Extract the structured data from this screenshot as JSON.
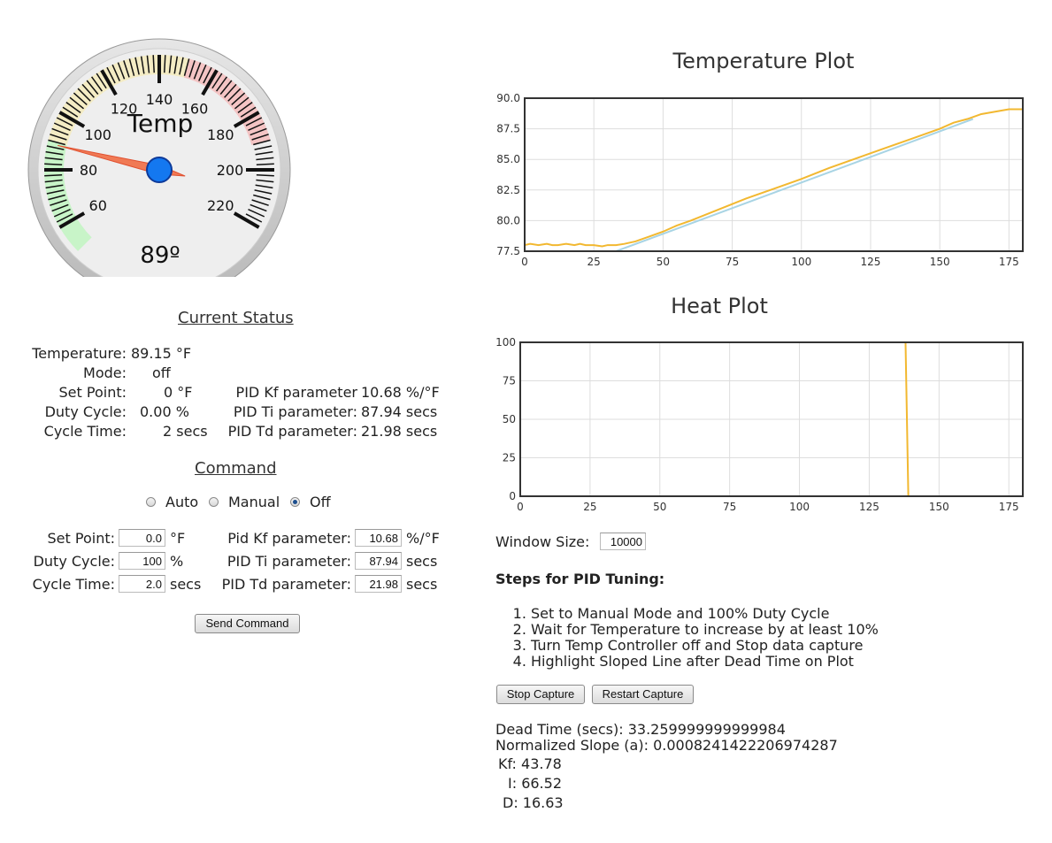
{
  "gauge": {
    "title": "Temp",
    "value_display": "89º",
    "value": 89,
    "min": 50,
    "max": 230,
    "major_ticks": [
      "60",
      "80",
      "100",
      "120",
      "140",
      "160",
      "180",
      "200",
      "220"
    ],
    "bands": [
      {
        "from": 50,
        "to": 90,
        "color": "#c8f4c8"
      },
      {
        "from": 90,
        "to": 150,
        "color": "#f4ecc4"
      },
      {
        "from": 150,
        "to": 190,
        "color": "#f4c4c4"
      }
    ]
  },
  "status": {
    "heading": "Current Status",
    "rows": [
      {
        "label": "Temperature:",
        "value": "89.15 °F"
      },
      {
        "label": "Mode:",
        "value": "off"
      },
      {
        "label": "Set Point:",
        "value": "0 °F"
      },
      {
        "label": "Duty Cycle:",
        "value": "0.00 %"
      },
      {
        "label": "Cycle Time:",
        "value": "2 secs"
      }
    ],
    "pid": [
      {
        "label": "PID Kf parameter",
        "value": "10.68 %/°F"
      },
      {
        "label": "PID Ti parameter:",
        "value": "87.94 secs"
      },
      {
        "label": "PID Td parameter:",
        "value": "21.98 secs"
      }
    ]
  },
  "command": {
    "heading": "Command",
    "modes": [
      {
        "label": "Auto",
        "selected": false
      },
      {
        "label": "Manual",
        "selected": false
      },
      {
        "label": "Off",
        "selected": true
      }
    ],
    "fields": [
      {
        "label": "Set Point:",
        "value": "0.0",
        "unit": "°F"
      },
      {
        "label": "Duty Cycle:",
        "value": "100",
        "unit": "%"
      },
      {
        "label": "Cycle Time:",
        "value": "2.0",
        "unit": "secs"
      }
    ],
    "pid_fields": [
      {
        "label": "Pid Kf parameter:",
        "value": "10.68",
        "unit": "%/°F"
      },
      {
        "label": "PID Ti parameter:",
        "value": "87.94",
        "unit": "secs"
      },
      {
        "label": "PID Td parameter:",
        "value": "21.98",
        "unit": "secs"
      }
    ],
    "send_label": "Send Command"
  },
  "chart_data": [
    {
      "type": "line",
      "title": "Temperature Plot",
      "xlim": [
        0,
        180
      ],
      "ylim": [
        77.5,
        90.0
      ],
      "xticks": [
        "0",
        "25",
        "50",
        "75",
        "100",
        "125",
        "150",
        "175"
      ],
      "yticks": [
        "77.5",
        "80.0",
        "82.5",
        "85.0",
        "87.5",
        "90.0"
      ],
      "grid": true,
      "series": [
        {
          "color": "#f2b830",
          "x": [
            0,
            2,
            5,
            8,
            10,
            12,
            15,
            18,
            20,
            22,
            25,
            28,
            30,
            33,
            36,
            40,
            45,
            50,
            55,
            60,
            70,
            80,
            90,
            100,
            110,
            120,
            130,
            140,
            150,
            155,
            160,
            165,
            170,
            175,
            180
          ],
          "y": [
            78.0,
            78.1,
            78.0,
            78.1,
            78.0,
            78.0,
            78.1,
            78.0,
            78.1,
            78.0,
            78.0,
            77.9,
            78.0,
            78.0,
            78.1,
            78.3,
            78.7,
            79.1,
            79.6,
            80.0,
            80.9,
            81.8,
            82.6,
            83.4,
            84.3,
            85.1,
            85.9,
            86.7,
            87.5,
            88.0,
            88.3,
            88.7,
            88.9,
            89.1,
            89.1
          ]
        },
        {
          "color": "#a8d4e4",
          "x": [
            33,
            162
          ],
          "y": [
            77.5,
            88.3
          ]
        }
      ]
    },
    {
      "type": "line",
      "title": "Heat Plot",
      "xlim": [
        0,
        180
      ],
      "ylim": [
        0,
        100
      ],
      "xticks": [
        "0",
        "25",
        "50",
        "75",
        "100",
        "125",
        "150",
        "175"
      ],
      "yticks": [
        "0",
        "25",
        "50",
        "75",
        "100"
      ],
      "grid": true,
      "series": [
        {
          "color": "#f2b830",
          "x": [
            0,
            138,
            139,
            180
          ],
          "y": [
            100,
            100,
            0,
            0
          ]
        }
      ]
    }
  ],
  "window_size": {
    "label": "Window Size:",
    "value": "10000"
  },
  "steps": {
    "heading": "Steps for PID Tuning:",
    "items": [
      "Set to Manual Mode and 100% Duty Cycle",
      "Wait for Temperature to increase by at least 10%",
      "Turn Temp Controller off and Stop data capture",
      "Highlight Sloped Line after Dead Time on Plot"
    ]
  },
  "capture": {
    "stop_label": "Stop Capture",
    "restart_label": "Restart Capture"
  },
  "results": {
    "dead_time": "Dead Time (secs): 33.259999999999984",
    "slope": "Normalized Slope (a): 0.0008241422206974287",
    "kf": "Kf: 43.78",
    "i": "I: 66.52",
    "d": "D: 16.63"
  }
}
